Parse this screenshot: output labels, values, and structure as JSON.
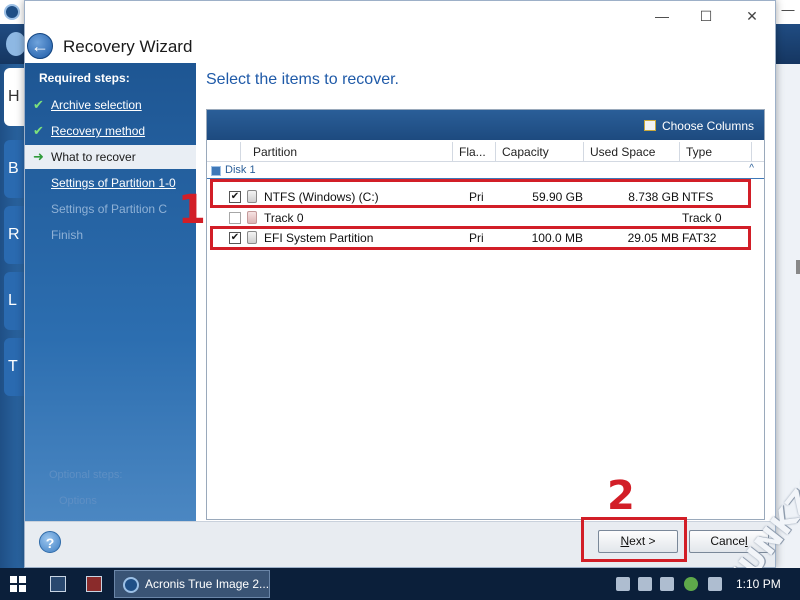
{
  "dialog": {
    "title": "Recovery Wizard",
    "window_controls": {
      "minimize": "—",
      "maximize": "☐",
      "close": "✕"
    }
  },
  "steps": {
    "heading": "Required steps:",
    "items": [
      {
        "label": "Archive selection",
        "state": "done",
        "mark": "✔"
      },
      {
        "label": "Recovery method",
        "state": "done",
        "mark": "✔"
      },
      {
        "label": "What to recover",
        "state": "current",
        "mark": "➜"
      },
      {
        "label": "Settings of Partition 1-0",
        "state": "link",
        "mark": ""
      },
      {
        "label": "Settings of Partition C",
        "state": "disabled",
        "mark": ""
      },
      {
        "label": "Finish",
        "state": "disabled",
        "mark": ""
      }
    ],
    "optional_heading": "Optional steps:",
    "optional_item": "Options"
  },
  "content": {
    "title": "Select the items to recover.",
    "choose_columns": "Choose Columns",
    "columns": [
      "Partition",
      "Fla...",
      "Capacity",
      "Used Space",
      "Type"
    ],
    "group": "Disk 1",
    "rows": [
      {
        "checked": "✔",
        "partition": "NTFS (Windows) (C:)",
        "flags": "Pri",
        "capacity": "59.90 GB",
        "used": "8.738 GB",
        "type": "NTFS"
      },
      {
        "checked": "",
        "partition": "Track 0",
        "flags": "",
        "capacity": "",
        "used": "",
        "type": "Track 0"
      },
      {
        "checked": "✔",
        "partition": "EFI System Partition",
        "flags": "Pri",
        "capacity": "100.0 MB",
        "used": "29.05 MB",
        "type": "FAT32"
      }
    ]
  },
  "footer": {
    "help": "?",
    "next_main": "N",
    "next_rest": "ext >",
    "cancel_main": "Cance",
    "cancel_rest": "l"
  },
  "annotations": {
    "one": "1",
    "two": "2"
  },
  "background": {
    "tiles": [
      "H",
      "B",
      "R",
      "L",
      "T"
    ]
  },
  "taskbar": {
    "app_label": "Acronis True Image 2...",
    "time": "1:10 PM"
  },
  "watermark": "FUNKZS.COM",
  "colors": {
    "accent": "#1f5aa8",
    "highlight": "#d21e27",
    "panel": "#1e5693"
  }
}
